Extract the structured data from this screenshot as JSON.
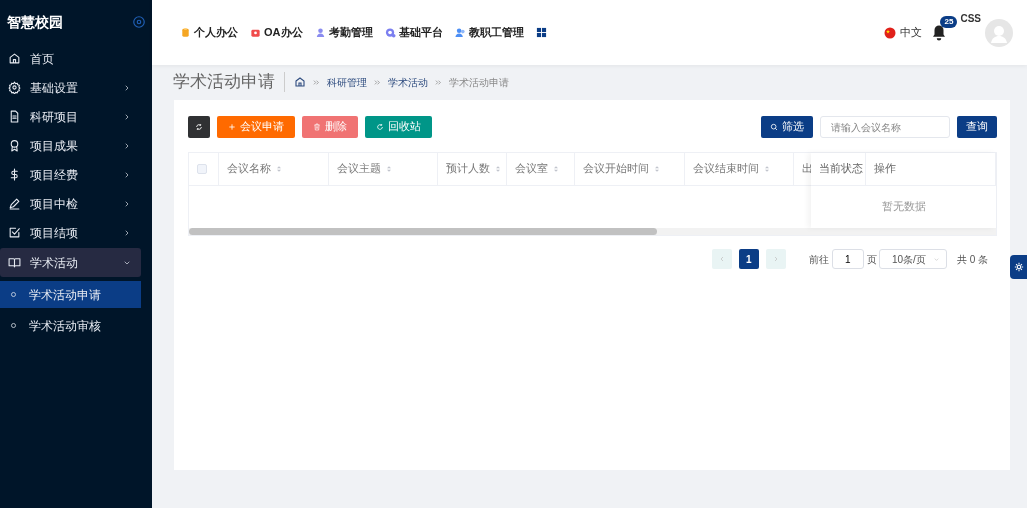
{
  "sidebar": {
    "brand": "智慧校园",
    "items": [
      {
        "kind": "link",
        "label": "首页",
        "selected": false
      },
      {
        "kind": "group",
        "label": "基础设置",
        "expanded": false,
        "selected": false
      },
      {
        "kind": "group",
        "label": "科研项目",
        "expanded": false,
        "selected": false
      },
      {
        "kind": "group",
        "label": "项目成果",
        "expanded": false,
        "selected": false
      },
      {
        "kind": "group",
        "label": "项目经费",
        "expanded": false,
        "selected": false
      },
      {
        "kind": "group",
        "label": "项目中检",
        "expanded": false,
        "selected": false
      },
      {
        "kind": "group",
        "label": "项目结项",
        "expanded": false,
        "selected": false
      },
      {
        "kind": "group",
        "label": "学术活动",
        "expanded": true,
        "selected": false,
        "children": [
          {
            "label": "学术活动申请",
            "selected": true
          },
          {
            "label": "学术活动审核",
            "selected": false
          }
        ]
      }
    ]
  },
  "top_nav": {
    "apps": [
      {
        "label": "个人办公",
        "color": "#f5a623"
      },
      {
        "label": "OA办公",
        "color": "#f04b4b"
      },
      {
        "label": "考勤管理",
        "color": "#8a8cf0"
      },
      {
        "label": "基础平台",
        "color": "#7b7ff0"
      },
      {
        "label": "教职工管理",
        "color": "#4d8ff5"
      }
    ],
    "language": "中文",
    "notification_count": "25",
    "username": "CSS"
  },
  "page": {
    "title": "学术活动申请",
    "breadcrumb": [
      "科研管理",
      "学术活动",
      "学术活动申请"
    ]
  },
  "toolbar": {
    "buttons": [
      {
        "kind": "refresh"
      },
      {
        "kind": "add",
        "label": "会议申请"
      },
      {
        "kind": "delete",
        "label": "删除"
      },
      {
        "kind": "recycle",
        "label": "回收站"
      }
    ],
    "filter_button": "筛选",
    "search": {
      "placeholder": "请输入会议名称"
    },
    "query_button": "查询"
  },
  "table": {
    "columns": [
      {
        "label": "会议名称",
        "sortable": true
      },
      {
        "label": "会议主题",
        "sortable": true
      },
      {
        "label": "预计人数",
        "sortable": true
      },
      {
        "label": "会议室",
        "sortable": true
      },
      {
        "label": "会议开始时间",
        "sortable": true
      },
      {
        "label": "会议结束时间",
        "sortable": true
      },
      {
        "label": "出"
      }
    ],
    "fixed_columns": [
      {
        "label": "当前状态"
      },
      {
        "label": "操作"
      }
    ],
    "empty_text": "暂无数据",
    "select_all_checked": false
  },
  "pagination": {
    "pages": [
      {
        "label": "1",
        "selected": true
      }
    ],
    "prev_disabled": true,
    "next_disabled": true,
    "goto_label": "前往",
    "goto_value": "1",
    "page_unit": "页",
    "page_size": "10条/页",
    "total": "共 0 条"
  }
}
